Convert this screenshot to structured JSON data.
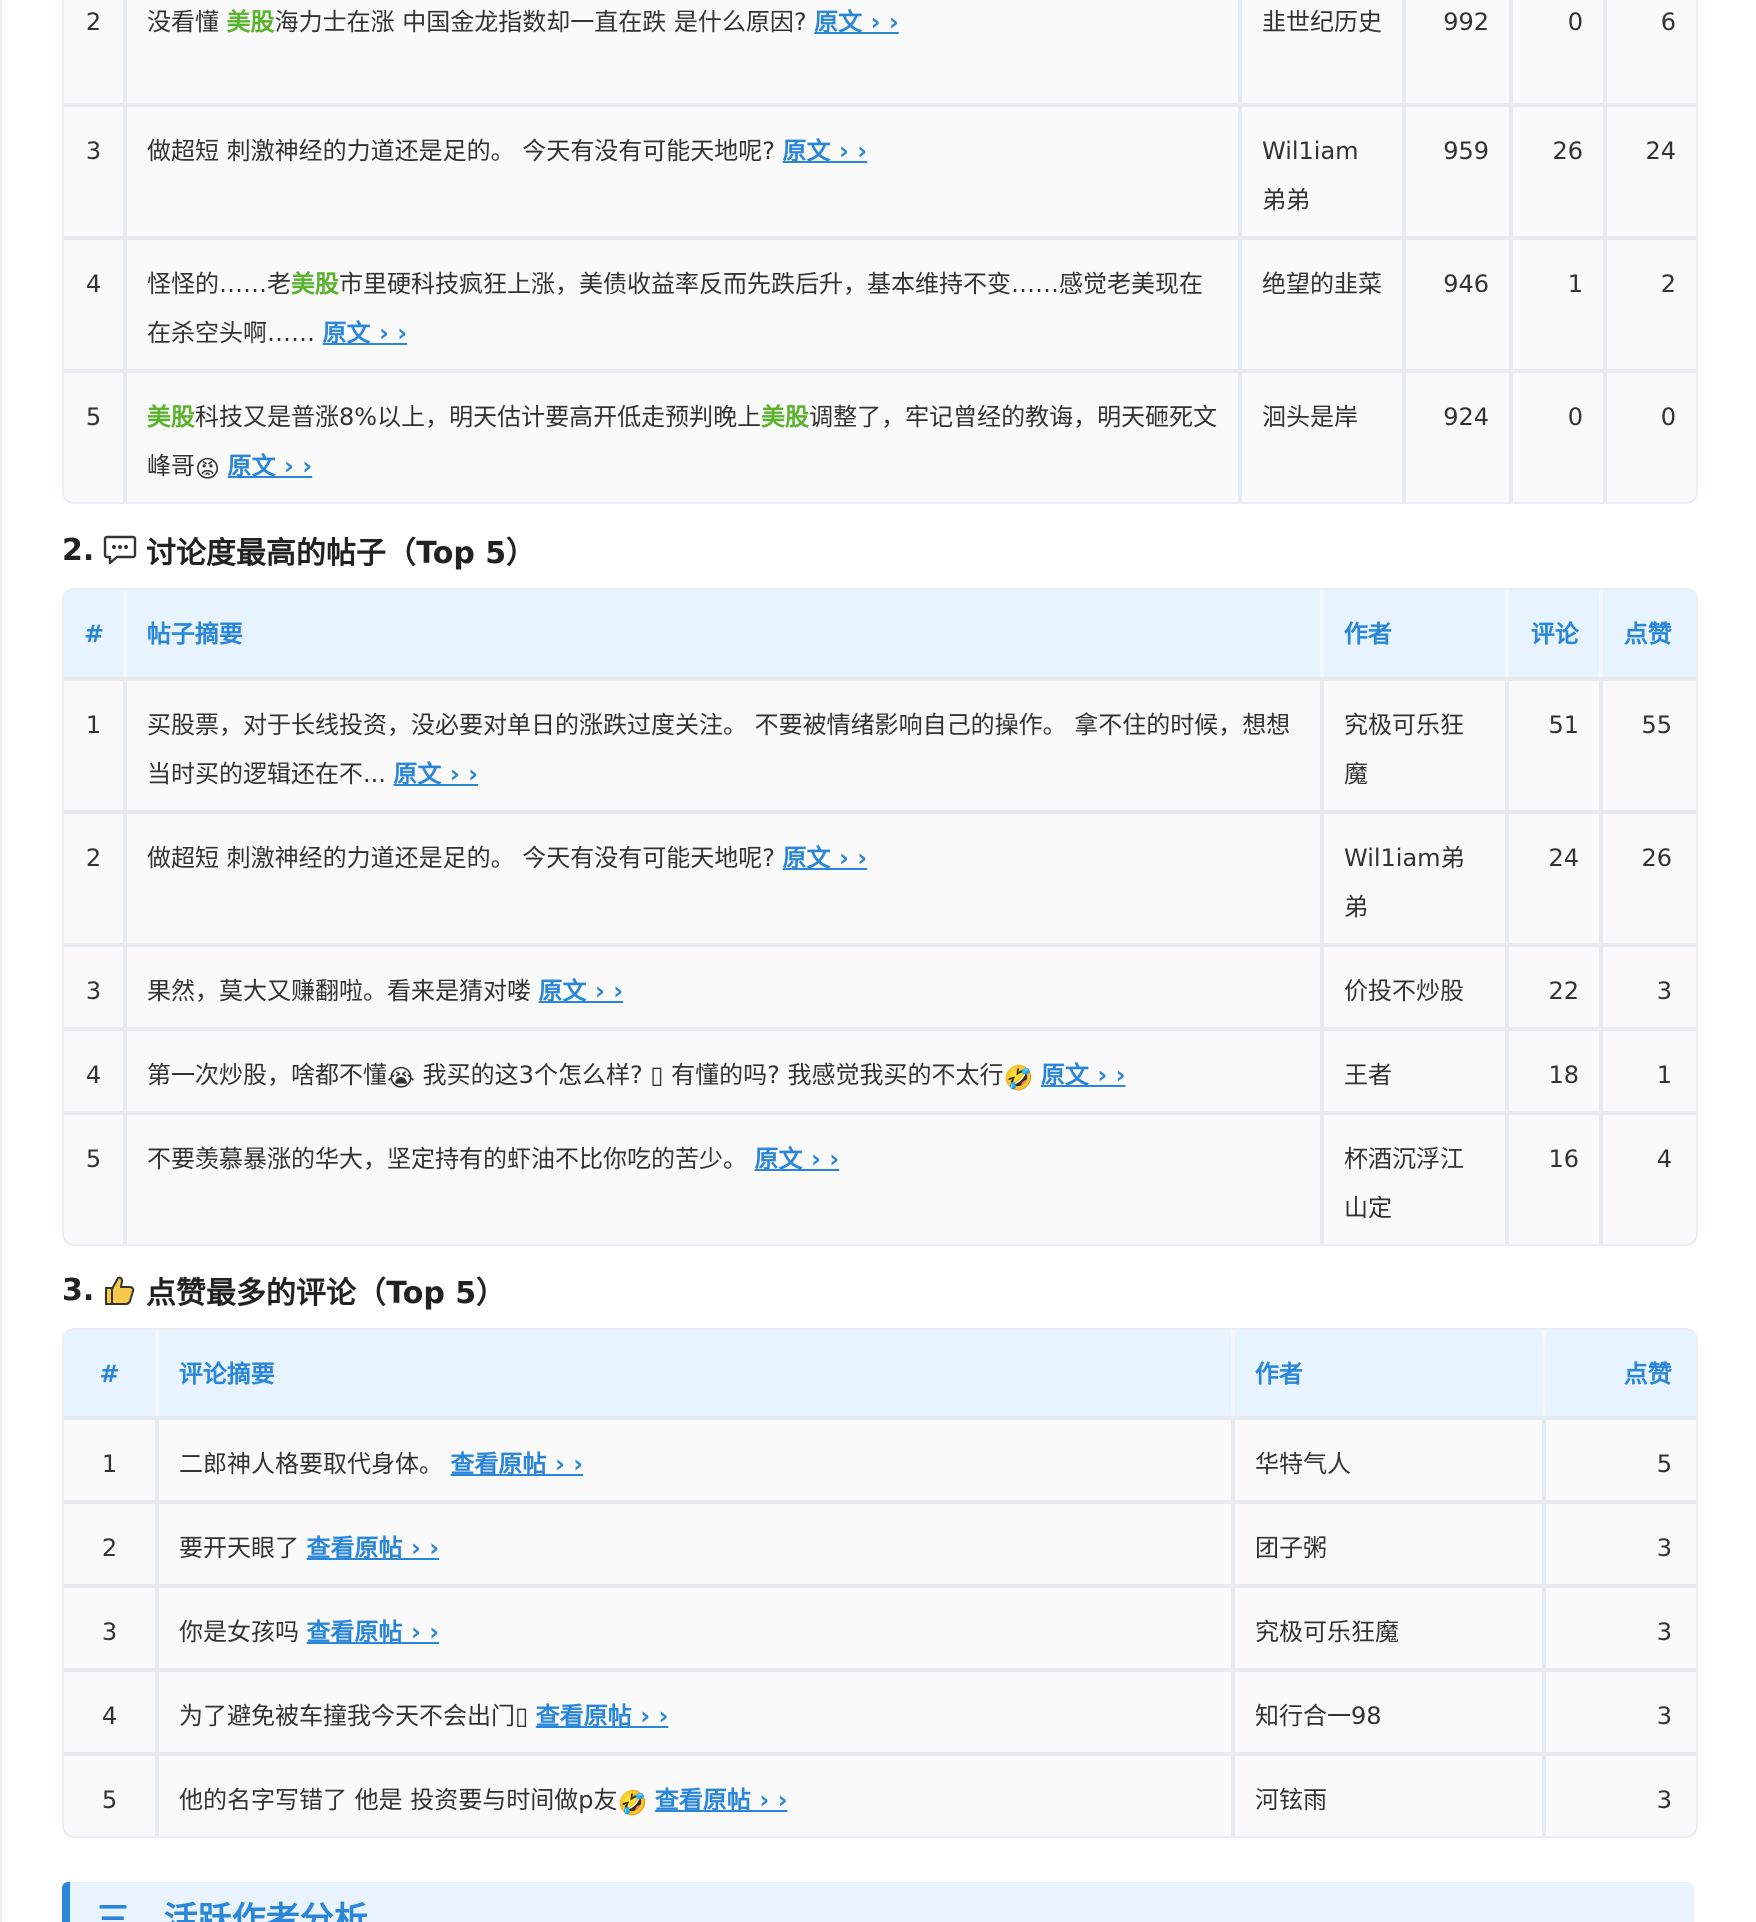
{
  "link_text": "原文 › ›",
  "view_link_text": "查看原帖 › ›",
  "colors": {
    "accent": "#2a86d8",
    "highlight": "#5ab32e",
    "header_bg": "#e7f3fe"
  },
  "t0": {
    "rows": [
      {
        "rank": "2",
        "s1": "没看懂 ",
        "kw1": "美股",
        "s2": "海力士在涨 中国金龙指数却一直在跌 是什么原因?",
        "author": "韭世纪历史",
        "a": "992",
        "b": "0",
        "c": "6"
      },
      {
        "rank": "3",
        "s1": "做超短 刺激神经的力道还是足的。 今天有没有可能天地呢?",
        "author": "Wil1iam弟弟",
        "a": "959",
        "b": "26",
        "c": "24"
      },
      {
        "rank": "4",
        "s1": "怪怪的……老",
        "kw1": "美股",
        "s2": "市里硬科技疯狂上涨，美债收益率反而先跌后升，基本维持不变……感觉老美现在在杀空头啊……",
        "author": "绝望的韭菜",
        "a": "946",
        "b": "1",
        "c": "2"
      },
      {
        "rank": "5",
        "kw1": "美股",
        "s1": "科技又是普涨8%以上，明天估计要高开低走预判晚上",
        "kw2": "美股",
        "s2": "调整了，牢记曾经的教诲，明天砸死文峰哥",
        "author": "洄头是岸",
        "a": "924",
        "b": "0",
        "c": "0"
      }
    ]
  },
  "sections": {
    "s2": {
      "num": "2.",
      "title": "讨论度最高的帖子（Top 5）"
    },
    "s3": {
      "num": "3.",
      "title": "点赞最多的评论（Top 5）"
    },
    "s_three": {
      "title": "三、活跃作者分析"
    }
  },
  "t2": {
    "headers": [
      "#",
      "帖子摘要",
      "作者",
      "评论",
      "点赞"
    ],
    "rows": [
      {
        "rank": "1",
        "s1": "买股票，对于长线投资，没必要对单日的涨跌过度关注。 不要被情绪影响自己的操作。 拿不住的时候，想想当时买的逻辑还在不...",
        "author": "究极可乐狂魔",
        "comments": "51",
        "likes": "55"
      },
      {
        "rank": "2",
        "s1": "做超短 刺激神经的力道还是足的。 今天有没有可能天地呢?",
        "author": "Wil1iam弟弟",
        "comments": "24",
        "likes": "26"
      },
      {
        "rank": "3",
        "s1": "果然，莫大又赚翻啦。看来是猜对喽",
        "author": "价投不炒股",
        "comments": "22",
        "likes": "3"
      },
      {
        "rank": "4",
        "s1": "第一次炒股，啥都不懂",
        "s2": " 我买的这3个怎么样? ▯ 有懂的吗? 我感觉我买的不太行",
        "author": "王者",
        "comments": "18",
        "likes": "1"
      },
      {
        "rank": "5",
        "s1": "不要羡慕暴涨的华大，坚定持有的虾油不比你吃的苦少。",
        "author": "杯酒沉浮江山定",
        "comments": "16",
        "likes": "4"
      }
    ]
  },
  "t3": {
    "headers": [
      "#",
      "评论摘要",
      "作者",
      "点赞"
    ],
    "rows": [
      {
        "rank": "1",
        "s1": "二郎神人格要取代身体。",
        "author": "华特气人",
        "likes": "5"
      },
      {
        "rank": "2",
        "s1": "要开天眼了",
        "author": "团子粥",
        "likes": "3"
      },
      {
        "rank": "3",
        "s1": "你是女孩吗",
        "author": "究极可乐狂魔",
        "likes": "3"
      },
      {
        "rank": "4",
        "s1": "为了避免被车撞我今天不会出门▯",
        "author": "知行合一98",
        "likes": "3"
      },
      {
        "rank": "5",
        "s1": "他的名字写错了 他是 投资要与时间做p友",
        "author": "河铉雨",
        "likes": "3"
      }
    ]
  }
}
